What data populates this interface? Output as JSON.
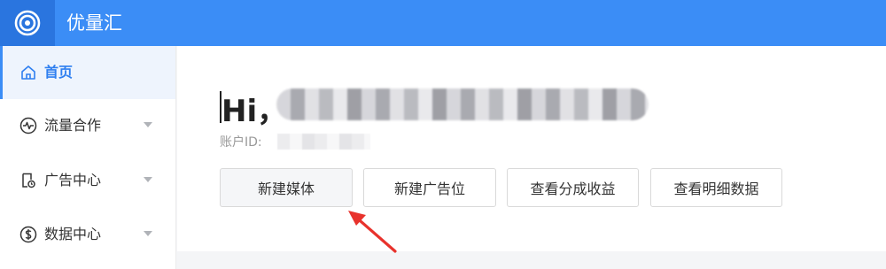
{
  "header": {
    "brand": "优量汇",
    "logo_icon": "target-logo-icon"
  },
  "sidebar": {
    "items": [
      {
        "label": "首页",
        "icon": "home-icon",
        "active": true
      },
      {
        "label": "流量合作",
        "icon": "pulse-icon",
        "active": false,
        "expandable": true
      },
      {
        "label": "广告中心",
        "icon": "ad-document-icon",
        "active": false,
        "expandable": true
      },
      {
        "label": "数据中心",
        "icon": "dollar-circle-icon",
        "active": false,
        "expandable": true
      }
    ]
  },
  "main": {
    "greeting": "Hi，",
    "account_label": "账户ID:",
    "buttons": [
      {
        "label": "新建媒体"
      },
      {
        "label": "新建广告位"
      },
      {
        "label": "查看分成收益"
      },
      {
        "label": "查看明细数据"
      }
    ]
  },
  "colors": {
    "header": "#3b8df6",
    "logo_bg": "#2a75df",
    "active_item_bg": "#eef4fd",
    "active_text": "#2f7ff0",
    "annotation_arrow": "#e8322c"
  }
}
